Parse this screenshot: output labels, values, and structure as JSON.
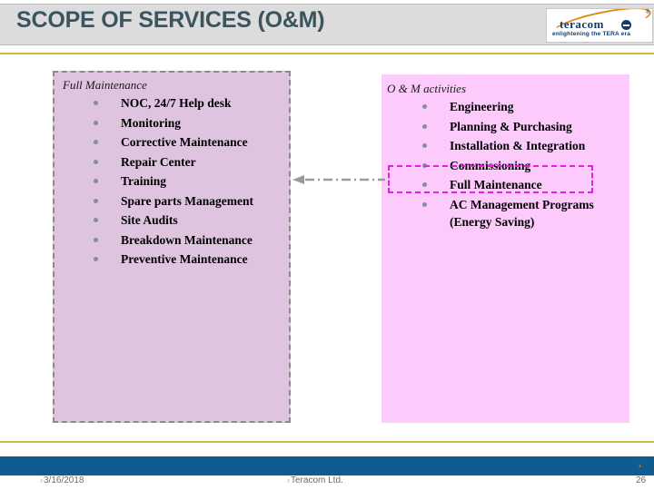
{
  "header": {
    "title": "SCOPE OF SERVICES (O&M)",
    "title_color": "#3a5560",
    "background_color": "#dcdcdc"
  },
  "logo": {
    "wordmark": "teracom",
    "tagline": "enlightening the TERA era",
    "trademark": "®",
    "accent_color": "#e08a1e",
    "text_color": "#123a6b"
  },
  "left_box": {
    "heading": "Full Maintenance",
    "fill_color": "#dfc4df",
    "border_color": "#8a8a8a",
    "items": [
      "NOC, 24/7 Help desk",
      "Monitoring",
      "Corrective Maintenance",
      "Repair Center",
      "Training",
      "Spare parts Management",
      "Site Audits",
      "Breakdown Maintenance",
      "Preventive Maintenance"
    ]
  },
  "right_box": {
    "heading": "O & M activities",
    "fill_color": "#fccbfc",
    "items": [
      "Engineering",
      "Planning & Purchasing",
      "Installation & Integration",
      "Commissioning",
      "Full Maintenance",
      "AC Management Programs (Energy Saving)"
    ],
    "highlighted_item": "Full Maintenance",
    "highlight_color": "#e81ce8"
  },
  "connector": {
    "style": "dash-dot arrow pointing left",
    "color": "#9a9a9a"
  },
  "footer": {
    "date": "3/16/2018",
    "company": "Teracom Ltd.",
    "page_number": "26",
    "marker": "›",
    "bar_color": "#0e5c92",
    "rule_color": "#d4b84a"
  }
}
